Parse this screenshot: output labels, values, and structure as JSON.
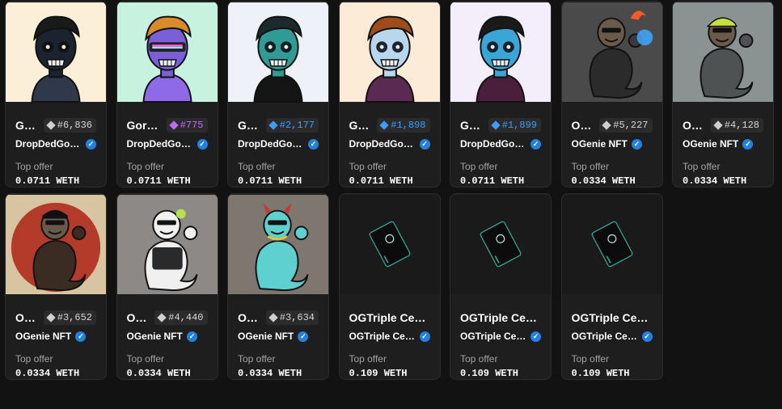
{
  "rows": [
    [
      {
        "name": "G…",
        "rank": "#6,836",
        "rank_color": "gray",
        "collection": "DropDedGor…",
        "offer_label": "Top offer",
        "offer_value": "0.0711 WETH",
        "bg": "#fcefd8",
        "art": "skull-dark"
      },
      {
        "name": "Gor…",
        "rank": "#775",
        "rank_color": "purple",
        "collection": "DropDedGor…",
        "offer_label": "Top offer",
        "offer_value": "0.0711 WETH",
        "bg": "#c8f2e0",
        "art": "skull-gold"
      },
      {
        "name": "G…",
        "rank": "#2,177",
        "rank_color": "blue",
        "collection": "DropDedGor…",
        "offer_label": "Top offer",
        "offer_value": "0.0711 WETH",
        "bg": "#eef2f8",
        "art": "skull-teal"
      },
      {
        "name": "G…",
        "rank": "#1,898",
        "rank_color": "blue",
        "collection": "DropDedGor…",
        "offer_label": "Top offer",
        "offer_value": "0.0711 WETH",
        "bg": "#fcebd6",
        "art": "skull-brown"
      },
      {
        "name": "G…",
        "rank": "#1,899",
        "rank_color": "blue",
        "collection": "DropDedGor…",
        "offer_label": "Top offer",
        "offer_value": "0.0711 WETH",
        "bg": "#f4eefa",
        "art": "skull-blue"
      },
      {
        "name": "O…",
        "rank": "#5,227",
        "rank_color": "gray",
        "collection": "OGenie NFT",
        "offer_label": "Top offer",
        "offer_value": "0.0334 WETH",
        "bg": "#4a4a4a",
        "art": "genie-dark"
      },
      {
        "name": "O…",
        "rank": "#4,128",
        "rank_color": "gray",
        "collection": "OGenie NFT",
        "offer_label": "Top offer",
        "offer_value": "0.0334 WETH",
        "bg": "#8a9292",
        "art": "genie-gray"
      }
    ],
    [
      {
        "name": "O…",
        "rank": "#3,652",
        "rank_color": "gray",
        "collection": "OGenie NFT",
        "offer_label": "Top offer",
        "offer_value": "0.0334 WETH",
        "bg": "#d7c5a2",
        "art": "genie-leopard"
      },
      {
        "name": "O…",
        "rank": "#4,440",
        "rank_color": "gray",
        "collection": "OGenie NFT",
        "offer_label": "Top offer",
        "offer_value": "0.0334 WETH",
        "bg": "#8c8987",
        "art": "genie-white"
      },
      {
        "name": "O…",
        "rank": "#3,634",
        "rank_color": "gray",
        "collection": "OGenie NFT",
        "offer_label": "Top offer",
        "offer_value": "0.0334 WETH",
        "bg": "#7d7770",
        "art": "genie-cyan"
      },
      {
        "name": "OGTriple Cert…",
        "rank": "",
        "rank_color": "",
        "collection": "OGTriple Certifi…",
        "offer_label": "Top offer",
        "offer_value": "0.109 WETH",
        "bg": "#1a1a1a",
        "art": "cert"
      },
      {
        "name": "OGTriple Cert…",
        "rank": "",
        "rank_color": "",
        "collection": "OGTriple Certifi…",
        "offer_label": "Top offer",
        "offer_value": "0.109 WETH",
        "bg": "#1a1a1a",
        "art": "cert"
      },
      {
        "name": "OGTriple Cert…",
        "rank": "",
        "rank_color": "",
        "collection": "OGTriple Certifi…",
        "offer_label": "Top offer",
        "offer_value": "0.109 WETH",
        "bg": "#1a1a1a",
        "art": "cert"
      }
    ]
  ],
  "colors": {
    "gray": "#cfcfcf",
    "blue": "#3b9dff",
    "purple": "#c069ff",
    "verified": "#2081e2"
  },
  "icons": {
    "verified": "verified-badge-icon",
    "rank": "diamond-icon"
  }
}
